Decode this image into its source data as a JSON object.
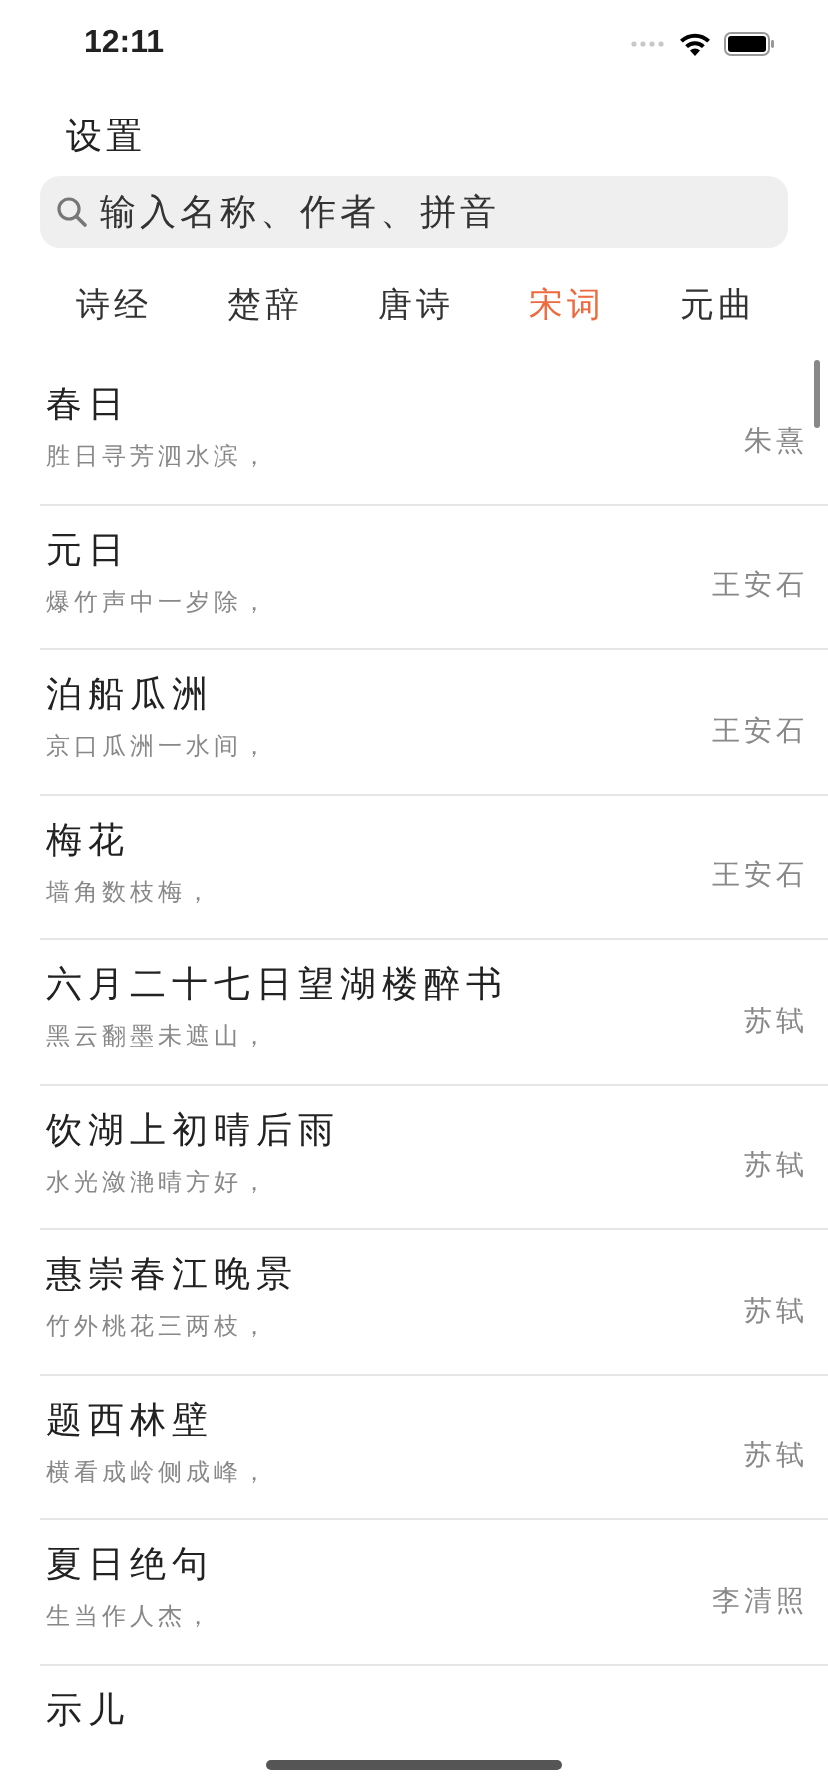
{
  "status_bar": {
    "time": "12:11"
  },
  "header": {
    "settings_link": "设置"
  },
  "search": {
    "placeholder": "输入名称、作者、拼音"
  },
  "tabs": [
    {
      "label": "诗经",
      "selected": false
    },
    {
      "label": "楚辞",
      "selected": false
    },
    {
      "label": "唐诗",
      "selected": false
    },
    {
      "label": "宋词",
      "selected": true
    },
    {
      "label": "元曲",
      "selected": false
    }
  ],
  "poems": [
    {
      "title": "春日",
      "first_line": "胜日寻芳泗水滨，",
      "author": "朱熹"
    },
    {
      "title": "元日",
      "first_line": "爆竹声中一岁除，",
      "author": "王安石"
    },
    {
      "title": "泊船瓜洲",
      "first_line": "京口瓜洲一水间，",
      "author": "王安石"
    },
    {
      "title": "梅花",
      "first_line": "墙角数枝梅，",
      "author": "王安石"
    },
    {
      "title": "六月二十七日望湖楼醉书",
      "first_line": "黑云翻墨未遮山，",
      "author": "苏轼"
    },
    {
      "title": "饮湖上初晴后雨",
      "first_line": "水光潋滟晴方好，",
      "author": "苏轼"
    },
    {
      "title": "惠崇春江晚景",
      "first_line": "竹外桃花三两枝，",
      "author": "苏轼"
    },
    {
      "title": "题西林壁",
      "first_line": "横看成岭侧成峰，",
      "author": "苏轼"
    },
    {
      "title": "夏日绝句",
      "first_line": "生当作人杰，",
      "author": "李清照"
    },
    {
      "title": "示儿"
    }
  ]
}
